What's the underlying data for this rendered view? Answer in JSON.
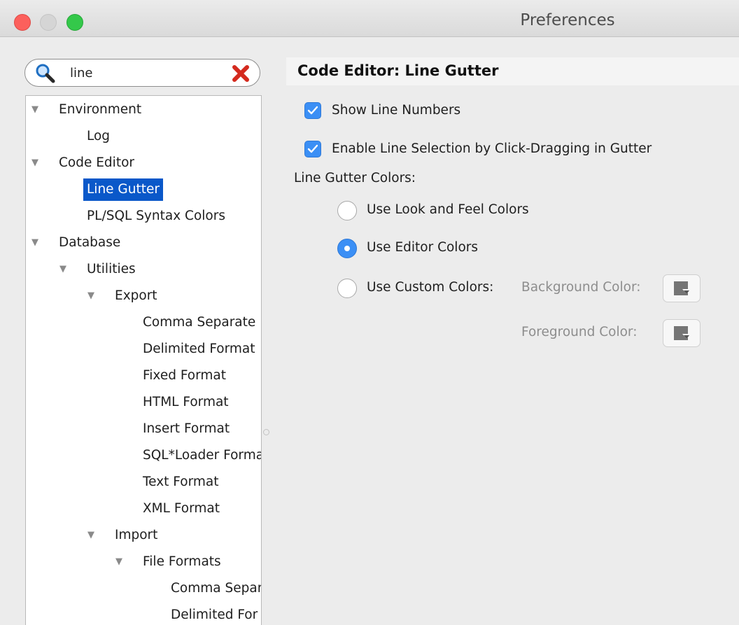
{
  "window": {
    "title": "Preferences"
  },
  "search": {
    "value": "line"
  },
  "tree": [
    {
      "label": "Environment",
      "expanded": true
    },
    {
      "label": "Log"
    },
    {
      "label": "Code Editor",
      "expanded": true
    },
    {
      "label": "Line Gutter",
      "selected": true
    },
    {
      "label": "PL/SQL Syntax Colors"
    },
    {
      "label": "Database",
      "expanded": true
    },
    {
      "label": "Utilities",
      "expanded": true
    },
    {
      "label": "Export",
      "expanded": true
    },
    {
      "label": "Comma Separate"
    },
    {
      "label": "Delimited Format"
    },
    {
      "label": "Fixed Format"
    },
    {
      "label": "HTML Format"
    },
    {
      "label": "Insert Format"
    },
    {
      "label": "SQL*Loader Forma"
    },
    {
      "label": "Text Format"
    },
    {
      "label": "XML Format"
    },
    {
      "label": "Import",
      "expanded": true
    },
    {
      "label": "File Formats",
      "expanded": true
    },
    {
      "label": "Comma Separ"
    },
    {
      "label": "Delimited For"
    }
  ],
  "panel": {
    "title": "Code Editor: Line Gutter",
    "show_line_numbers": {
      "label": "Show Line Numbers",
      "checked": true
    },
    "enable_line_selection": {
      "label": "Enable Line Selection by Click-Dragging in Gutter",
      "checked": true
    },
    "colors_heading": "Line Gutter Colors:",
    "radio_look_feel": {
      "label": "Use Look and Feel Colors",
      "selected": false
    },
    "radio_editor": {
      "label": "Use Editor Colors",
      "selected": true
    },
    "radio_custom": {
      "label": "Use Custom Colors:",
      "selected": false
    },
    "background_color_label": "Background Color:",
    "foreground_color_label": "Foreground Color:"
  },
  "colors": {
    "accent": "#3b8ff5",
    "selection": "#0a58c9"
  }
}
